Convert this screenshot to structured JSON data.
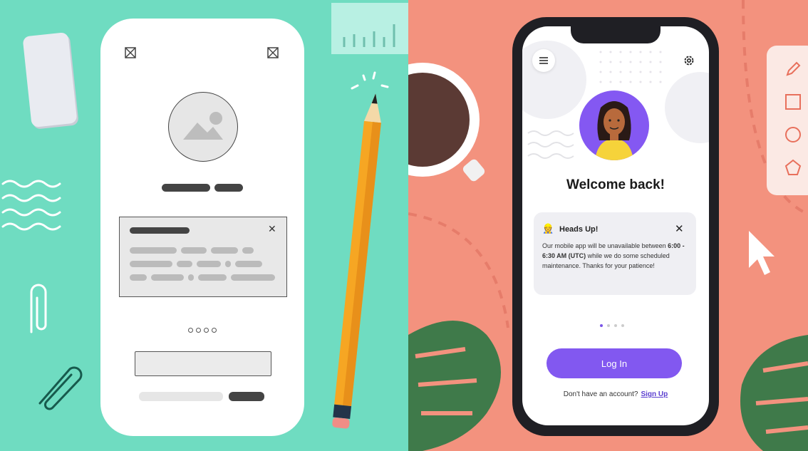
{
  "wireframe": {
    "pager_dots": 4
  },
  "mockup": {
    "welcome_title": "Welcome back!",
    "alert": {
      "emoji": "👷",
      "title": "Heads Up!",
      "close": "✕",
      "body_prefix": "Our mobile app will be unavailable between ",
      "body_time": "6:00 - 6:30 AM (UTC)",
      "body_suffix": " while we do some scheduled maintenance. Thanks for your patience!"
    },
    "pager": {
      "count": 4,
      "active": 0
    },
    "login_label": "Log In",
    "signup_prompt": "Don't have an account?",
    "signup_link": "Sign Up"
  },
  "colors": {
    "left_bg": "#6fdcc1",
    "right_bg": "#f3927e",
    "accent": "#8258f0"
  },
  "icons": [
    "image-placeholder-icon",
    "close-icon",
    "menu-icon",
    "settings-icon",
    "pencil-icon",
    "square-icon",
    "circle-icon",
    "pentagon-icon",
    "cursor-icon"
  ]
}
